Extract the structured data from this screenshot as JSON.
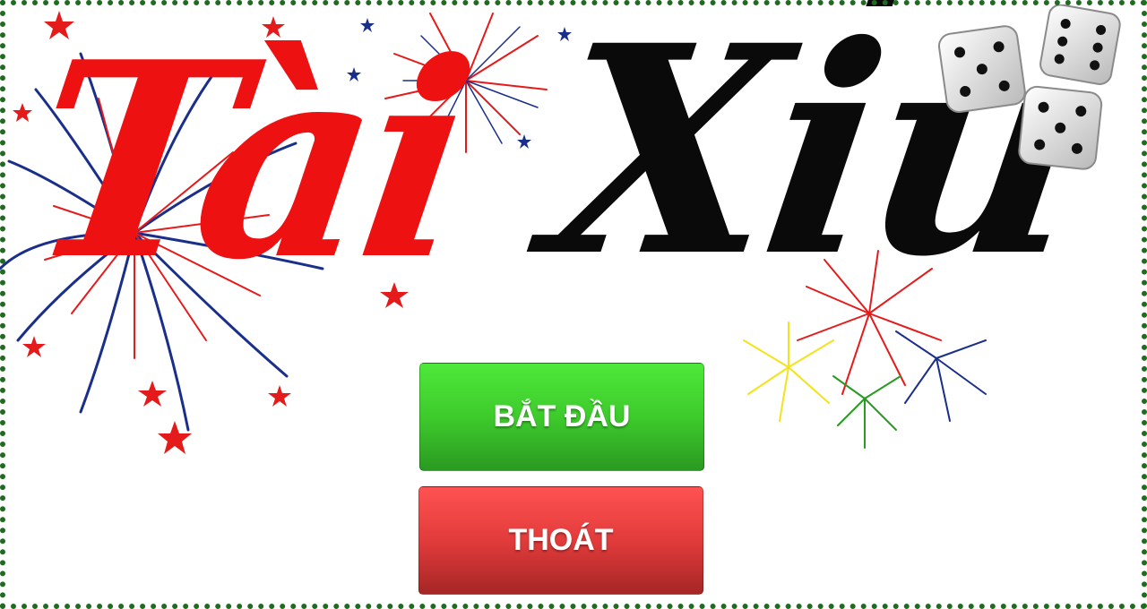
{
  "logo": {
    "word1": "Tài",
    "word2": "Xỉu"
  },
  "menu": {
    "start_label": "BẮT ĐẦU",
    "exit_label": "THOÁT"
  },
  "colors": {
    "start_button": "#3ecb2c",
    "exit_button": "#e23b3b",
    "frame_dots": "#1f6b1f",
    "title_red": "#ee1111",
    "title_black": "#0a0a0a"
  },
  "icons": [
    "fireworks-illustration",
    "dice-icon"
  ]
}
